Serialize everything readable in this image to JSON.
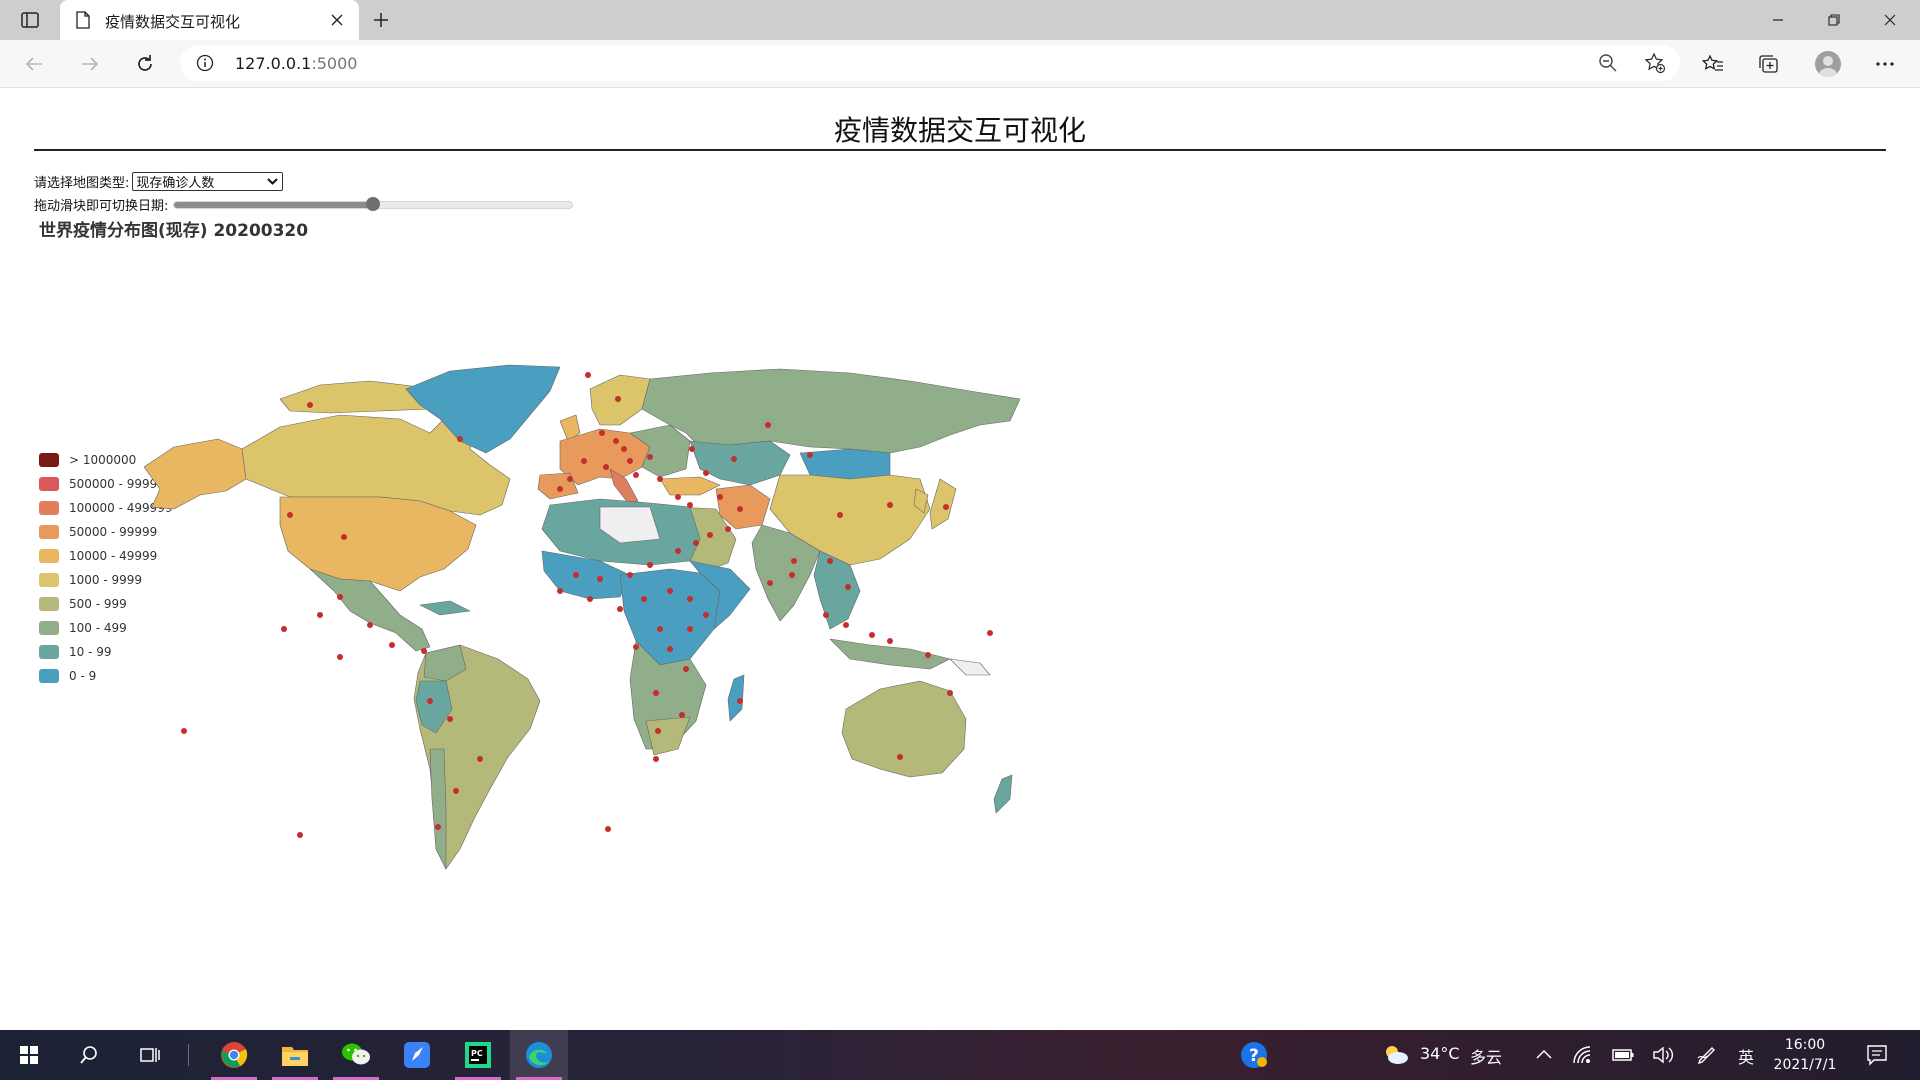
{
  "browser": {
    "tab_title": "疫情数据交互可视化",
    "url_host": "127.0.0.1",
    "url_port": ":5000"
  },
  "page": {
    "title": "疫情数据交互可视化",
    "map_type_label": "请选择地图类型:",
    "map_type_selected": "现存确诊人数",
    "slider_label": "拖动滑块即可切换日期:",
    "slider_position": 0.5,
    "map_title": "世界疫情分布图(现存) 20200320"
  },
  "legend": [
    {
      "label": "> 1000000",
      "color": "#7b1919"
    },
    {
      "label": "500000 - 999999",
      "color": "#d9585a"
    },
    {
      "label": "100000 - 499999",
      "color": "#e07e5e"
    },
    {
      "label": "50000 - 99999",
      "color": "#e79a5c"
    },
    {
      "label": "10000 - 49999",
      "color": "#e9b761"
    },
    {
      "label": "1000 - 9999",
      "color": "#dcc46a"
    },
    {
      "label": "500 - 999",
      "color": "#b4b97a"
    },
    {
      "label": "100 - 499",
      "color": "#91ae8a"
    },
    {
      "label": "10 - 99",
      "color": "#6aa6a0"
    },
    {
      "label": "0 - 9",
      "color": "#4a9ec0"
    }
  ],
  "taskbar": {
    "weather_temp": "34°C",
    "weather_desc": "多云",
    "ime": "英",
    "time": "16:00",
    "date": "2021/7/1"
  },
  "icons": [
    "tab-actions-icon",
    "page-icon",
    "close-icon",
    "plus-icon",
    "minimize-icon",
    "restore-icon",
    "back-icon",
    "forward-icon",
    "refresh-icon",
    "info-icon",
    "zoom-out-icon",
    "add-favorite-icon",
    "favorites-icon",
    "collections-icon",
    "profile-icon",
    "more-icon",
    "windows-start-icon",
    "search-icon",
    "task-view-icon",
    "chrome-icon",
    "file-explorer-icon",
    "wechat-icon",
    "app-icon",
    "pycharm-icon",
    "edge-icon",
    "help-icon",
    "weather-icon",
    "chevron-up-icon",
    "network-icon",
    "battery-icon",
    "volume-icon",
    "pen-icon",
    "notification-icon"
  ]
}
